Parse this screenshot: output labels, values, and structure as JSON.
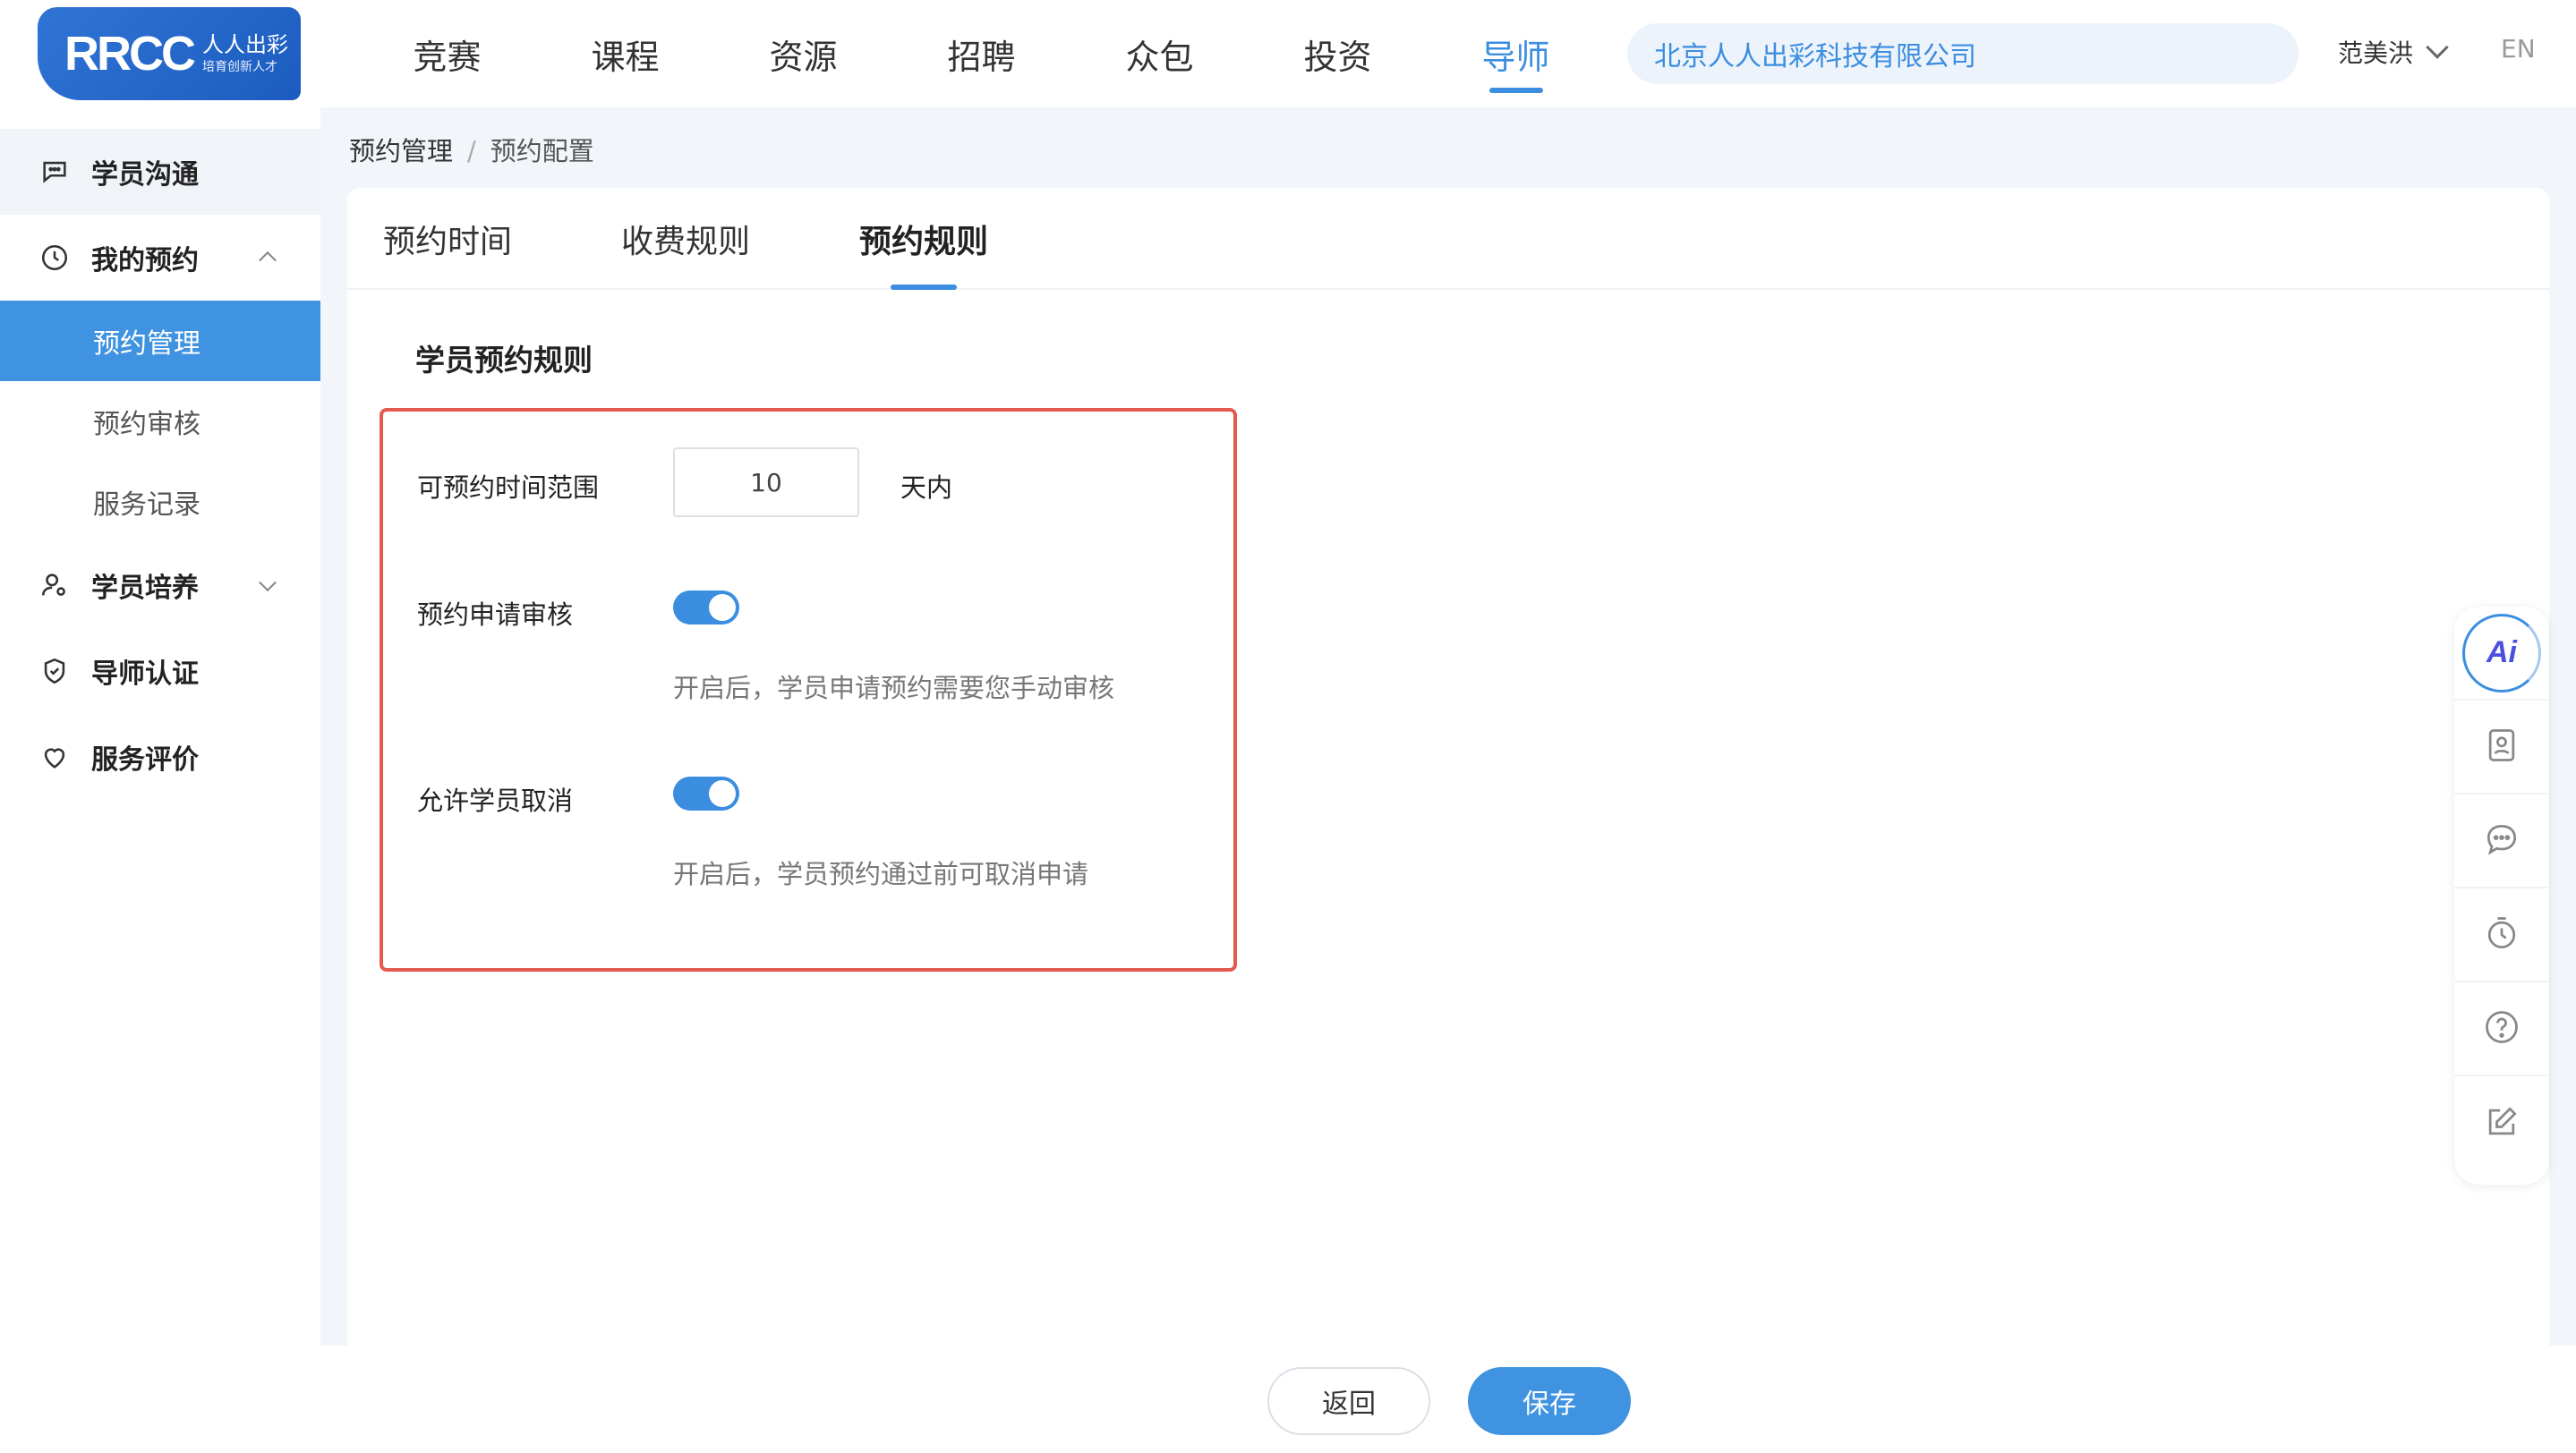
{
  "header": {
    "logo": {
      "main": "RRCC",
      "cn": "人人出彩",
      "sub": "培育创新人才"
    },
    "nav": [
      "竞赛",
      "课程",
      "资源",
      "招聘",
      "众包",
      "投资",
      "导师"
    ],
    "active_nav_index": 6,
    "org_search_value": "北京人人出彩科技有限公司",
    "user_name": "范美洪",
    "language": "EN"
  },
  "sidebar": {
    "items": [
      {
        "label": "学员沟通",
        "icon": "chat-icon"
      },
      {
        "label": "我的预约",
        "icon": "clock-icon",
        "expanded": true,
        "children": [
          "预约管理",
          "预约审核",
          "服务记录"
        ],
        "active_child": 0
      },
      {
        "label": "学员培养",
        "icon": "user-icon",
        "expanded": false
      },
      {
        "label": "导师认证",
        "icon": "shield-icon"
      },
      {
        "label": "服务评价",
        "icon": "heart-icon"
      }
    ]
  },
  "breadcrumb": {
    "parent": "预约管理",
    "separator": "/",
    "current": "预约配置"
  },
  "tabs": [
    "预约时间",
    "收费规则",
    "预约规则"
  ],
  "active_tab_index": 2,
  "rules": {
    "section_title": "学员预约规则",
    "range": {
      "label": "可预约时间范围",
      "value": "10",
      "unit": "天内"
    },
    "review": {
      "label": "预约申请审核",
      "enabled": true,
      "hint": "开启后，学员申请预约需要您手动审核"
    },
    "cancel": {
      "label": "允许学员取消",
      "enabled": true,
      "hint": "开启后，学员预约通过前可取消申请"
    }
  },
  "float_toolbar": {
    "ai_label": "Ai",
    "icons": [
      "ai-assistant-icon",
      "contact-card-icon",
      "message-icon",
      "timer-icon",
      "help-icon",
      "edit-icon"
    ]
  },
  "footer": {
    "back_label": "返回",
    "save_label": "保存"
  },
  "colors": {
    "accent": "#3b8de0",
    "highlight_border": "#e55a4e",
    "active_menu_bg": "#3f93e0"
  }
}
